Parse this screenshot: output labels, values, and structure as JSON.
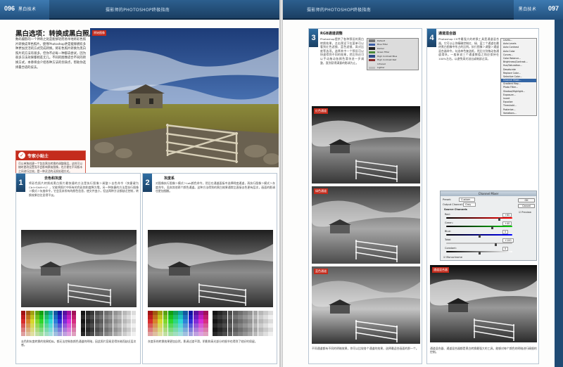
{
  "left_page": {
    "page_number": "096",
    "section": "黑白技术",
    "running_head": "摄影师的PHOTOSHOP终极指南",
    "title": "黑白选项：转换成黑白照片",
    "intro": "数码摄影的一个神奇之处是能够轻而易举地将彩色照片转换成单色照片，使用Photoshop更是能够拥有多种更加灵活的方式完成转换。将彩色照片转换为黑白照片的方法有很多，但你不必每一种都去尝试，因为很多方法效果都相差无几。不同的图像适合不同的转换方式，本章将会介绍各种方法的优缺点，帮助你选择最合适的技法。",
    "photo_tag": "原始图像",
    "tip": {
      "title": "专家小贴士",
      "body": "可以单独创建一个包含黑白转换的调整图层，这样可以随时更改设置而不会影响原始图像，也方便在不同版本之间进行比较，是一种灵活的无损处理方式。"
    },
    "steps": [
      {
        "num": "1",
        "title": "去色和灰度",
        "text": "将彩色照片转换成黑白照片最快捷的方法是执行图像＞调整＞去色命令（快捷键为Ctrl+Shift+U），它能将照片中所有的色彩饱和度降为零。另一种快捷的方法是执行图像＞模式＞灰度命令，它会丢弃所有的颜色信息，使文件变小，但这两种方法都缺乏控制，转换效果往往显得平淡。",
        "caption": "去色和灰度转换的效果相似，都无法控制各颜色通道的明暗，因此照片容易显得灰暗而缺乏层次感。"
      },
      {
        "num": "2",
        "title": "灰度系",
        "text": "对图像执行图像＞模式＞Lab颜色命令，然后在通道面板中选择明度通道，再执行图像＞模式＞灰度命令，丢弃其他两个颜色通道。这种方法得到的黑白效果通常比直接去色更有层次，画面的影调也更加细腻。",
        "caption": "灰度系的转换效果更加自然，影调过渡平滑，阴影和高光部分的细节也得到了较好的保留。"
      }
    ]
  },
  "right_page": {
    "page_number": "097",
    "section": "黑白技术",
    "running_head": "摄影师的PHOTOSHOP终极指南",
    "steps": [
      {
        "num": "3",
        "title": "RGB通道调整",
        "text": "Photoshop提供了各种预设的黑白转换效果，点击预设下拉菜单可以看到红色滤镜、蓝色滤镜、高对比度等选项。选择其中一个预设可以快速得到不同的效果，然后你还可以手动拖动各颜色滑块进一步调整，直到获得满意的影调为止。",
        "caption": "不同通道都有不同的明暗效果，你可以比较各个通道的效果，选择最适合画面的那一个。",
        "tags": [
          "红色通道",
          "绿色通道",
          "蓝色通道"
        ],
        "presets": [
          "Default",
          "Blue Filter",
          "Darker",
          "Green Filter",
          "High Contrast Blue",
          "High Contrast Red",
          "Infrared",
          "Lighter"
        ]
      },
      {
        "num": "4",
        "title": "通道混合器",
        "text": "Photoshop CS中最强大的转换工具是通道混合器，它可以让你精确控制红、绿、蓝三个通道在最终黑白图像中所占的比例。执行图像＞调整＞通道混合器命令，勾选单色复选框，然后分别拖动各通道滑块。一般来说三个通道数值之和应保持在100%左右，以避免高光溢出或暗部过深。",
        "caption": "通道混合器、通道混合器都是黑白转换最强大的工具，能够对每个颜色的明暗进行精细的控制。",
        "tag": "通道混合器",
        "menu": [
          "Levels...",
          "Auto Levels",
          "Auto Contrast",
          "Auto Color",
          "Curves...",
          "Color Balance...",
          "Brightness/Contrast...",
          "Hue/Saturation...",
          "Desaturate",
          "Replace Color...",
          "Selective Color...",
          "Channel Mixer...",
          "Gradient Map...",
          "Photo Filter...",
          "Shadow/Highlight...",
          "Exposure...",
          "Invert",
          "Equalize",
          "Threshold...",
          "Posterize...",
          "Variations..."
        ],
        "dialog": {
          "title": "Channel Mixer",
          "preset_label": "Preset:",
          "preset_value": "Custom",
          "output_label": "Output Channel:",
          "output_value": "Gray",
          "source_label": "Source Channels",
          "sliders": [
            {
              "name": "Red:",
              "value": "+60",
              "pct": 0.8
            },
            {
              "name": "Green:",
              "value": "+40",
              "pct": 0.7
            },
            {
              "name": "Blue:",
              "value": "0",
              "pct": 0.5
            },
            {
              "name": "Total:",
              "value": "+100",
              "pct": 0.75
            },
            {
              "name": "Constant:",
              "value": "0",
              "pct": 0.5
            }
          ],
          "monochrome": "Monochrome",
          "ok": "OK",
          "cancel": "Cancel",
          "preview": "Preview"
        }
      }
    ]
  },
  "colors": {
    "header": "#1f4a74",
    "accent": "#c42c1d",
    "step_badge": "#2f6ea3"
  }
}
